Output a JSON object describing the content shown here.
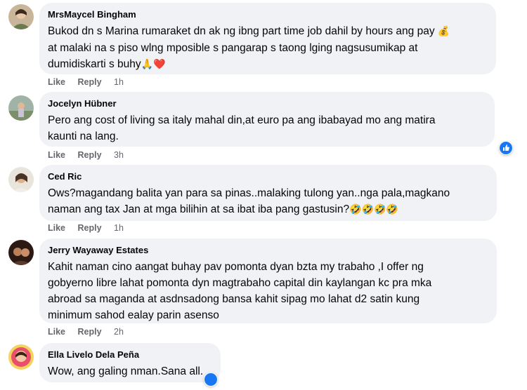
{
  "comments": [
    {
      "name": "MrsMaycel Bingham",
      "lines": [
        "Bukod dn s Marina rumaraket dn ak ng ibng part time job dahil by hours ang pay",
        "at malaki na s piso wlng mposible s pangarap s taong lging nagsusumikap at",
        "dumidiskarti s buhy"
      ],
      "emoji_line1": "💰",
      "emoji_line3": "🙏❤️",
      "like": "Like",
      "reply": "Reply",
      "time": "1h"
    },
    {
      "name": "Jocelyn Hübner",
      "lines": [
        "Pero ang cost of living sa italy mahal din,at euro pa ang ibabayad mo ang matira",
        "kaunti na lang."
      ],
      "like": "Like",
      "reply": "Reply",
      "time": "3h"
    },
    {
      "name": "Ced Ric",
      "lines": [
        "Ows?magandang balita yan para sa pinas..malaking tulong yan..nga pala,magkano",
        "naman ang tax Jan at mga bilihin at sa ibat iba pang gastusin?"
      ],
      "emoji_line2": "🤣🤣🤣🤣",
      "like": "Like",
      "reply": "Reply",
      "time": "1h"
    },
    {
      "name": "Jerry Wayaway Estates",
      "lines": [
        "Kahit naman cino aangat buhay pav pomonta dyan bzta my trabaho ,I offer ng",
        "gobyerno libre lahat pomonta dyn magtrabaho capital din kaylangan kc pra mka",
        "abroad sa maganda at asdnsadong bansa kahit sipag mo lahat d2 satin kung",
        "minimum sahod ealay parin asenso"
      ],
      "like": "Like",
      "reply": "Reply",
      "time": "2h"
    },
    {
      "name": "Ella Livelo Dela Peña",
      "lines": [
        "Wow, ang galing nman.Sana all."
      ]
    }
  ],
  "colors": {
    "bubble": "#f0f2f5",
    "meta": "#65676b",
    "like_blue": "#1877f2"
  },
  "icons": [
    "like-reaction-icon"
  ]
}
